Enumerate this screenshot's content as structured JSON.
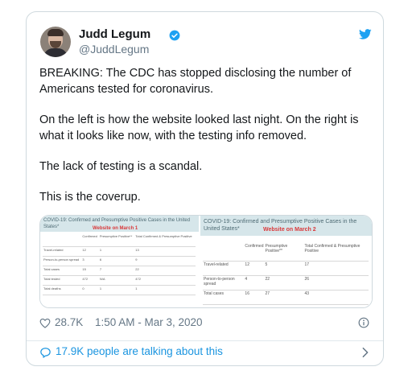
{
  "author": {
    "name": "Judd Legum",
    "handle": "@JuddLegum"
  },
  "tweet": {
    "paragraphs": [
      "BREAKING: The CDC has stopped disclosing the number of Americans tested for coronavirus.",
      "On the left is how the website looked last night. On the right is what it looks like now, with the testing info removed.",
      "The lack of testing is a scandal.",
      "This is the coverup."
    ]
  },
  "images": {
    "left": {
      "title": "COVID-19: Confirmed and Presumptive Positive Cases in the United States*",
      "label": "Website on March 1",
      "headers": [
        "",
        "Confirmed",
        "Presumptive Positive**",
        "Total Confirmed & Presumptive Positive"
      ],
      "rows": [
        [
          "Travel-related",
          "12",
          "1",
          "13"
        ],
        [
          "Person-to-person spread",
          "3",
          "6",
          "9"
        ],
        [
          "Total cases",
          "15",
          "7",
          "22"
        ],
        [
          "Total tested",
          "472",
          "N/A",
          "472"
        ],
        [
          "Total deaths",
          "0",
          "1",
          "1"
        ]
      ]
    },
    "right": {
      "title": "COVID-19: Confirmed and Presumptive Positive Cases in the United States*",
      "label": "Website on March 2",
      "headers": [
        "",
        "Confirmed",
        "Presumptive Positive**",
        "Total Confirmed & Presumptive Positive"
      ],
      "rows": [
        [
          "Travel-related",
          "12",
          "5",
          "17"
        ],
        [
          "Person-to-person spread",
          "4",
          "22",
          "26"
        ],
        [
          "Total cases",
          "16",
          "27",
          "43"
        ]
      ]
    }
  },
  "footer": {
    "likes": "28.7K",
    "timestamp": "1:50 AM - Mar 3, 2020"
  },
  "conversation": {
    "text": "17.9K people are talking about this"
  },
  "colors": {
    "brand_blue": "#1da1f2",
    "link_blue": "#1b95e0",
    "muted": "#657786",
    "highlight_red": "#d9383a"
  },
  "icons": [
    "verified-badge-icon",
    "twitter-bird-icon",
    "heart-icon",
    "info-icon",
    "conversation-icon",
    "chevron-right-icon"
  ]
}
